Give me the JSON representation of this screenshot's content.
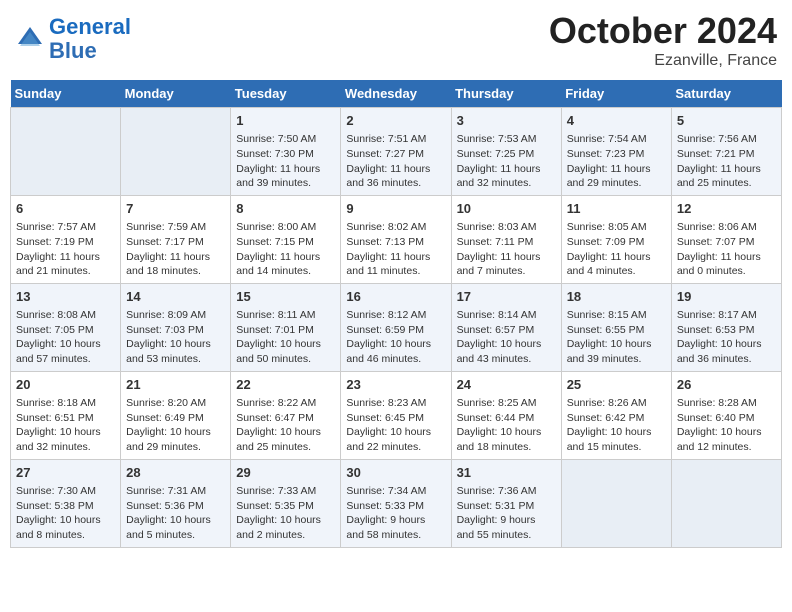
{
  "header": {
    "logo_line1": "General",
    "logo_line2": "Blue",
    "month": "October 2024",
    "location": "Ezanville, France"
  },
  "weekdays": [
    "Sunday",
    "Monday",
    "Tuesday",
    "Wednesday",
    "Thursday",
    "Friday",
    "Saturday"
  ],
  "weeks": [
    [
      {
        "day": "",
        "content": ""
      },
      {
        "day": "",
        "content": ""
      },
      {
        "day": "1",
        "content": "Sunrise: 7:50 AM\nSunset: 7:30 PM\nDaylight: 11 hours and 39 minutes."
      },
      {
        "day": "2",
        "content": "Sunrise: 7:51 AM\nSunset: 7:27 PM\nDaylight: 11 hours and 36 minutes."
      },
      {
        "day": "3",
        "content": "Sunrise: 7:53 AM\nSunset: 7:25 PM\nDaylight: 11 hours and 32 minutes."
      },
      {
        "day": "4",
        "content": "Sunrise: 7:54 AM\nSunset: 7:23 PM\nDaylight: 11 hours and 29 minutes."
      },
      {
        "day": "5",
        "content": "Sunrise: 7:56 AM\nSunset: 7:21 PM\nDaylight: 11 hours and 25 minutes."
      }
    ],
    [
      {
        "day": "6",
        "content": "Sunrise: 7:57 AM\nSunset: 7:19 PM\nDaylight: 11 hours and 21 minutes."
      },
      {
        "day": "7",
        "content": "Sunrise: 7:59 AM\nSunset: 7:17 PM\nDaylight: 11 hours and 18 minutes."
      },
      {
        "day": "8",
        "content": "Sunrise: 8:00 AM\nSunset: 7:15 PM\nDaylight: 11 hours and 14 minutes."
      },
      {
        "day": "9",
        "content": "Sunrise: 8:02 AM\nSunset: 7:13 PM\nDaylight: 11 hours and 11 minutes."
      },
      {
        "day": "10",
        "content": "Sunrise: 8:03 AM\nSunset: 7:11 PM\nDaylight: 11 hours and 7 minutes."
      },
      {
        "day": "11",
        "content": "Sunrise: 8:05 AM\nSunset: 7:09 PM\nDaylight: 11 hours and 4 minutes."
      },
      {
        "day": "12",
        "content": "Sunrise: 8:06 AM\nSunset: 7:07 PM\nDaylight: 11 hours and 0 minutes."
      }
    ],
    [
      {
        "day": "13",
        "content": "Sunrise: 8:08 AM\nSunset: 7:05 PM\nDaylight: 10 hours and 57 minutes."
      },
      {
        "day": "14",
        "content": "Sunrise: 8:09 AM\nSunset: 7:03 PM\nDaylight: 10 hours and 53 minutes."
      },
      {
        "day": "15",
        "content": "Sunrise: 8:11 AM\nSunset: 7:01 PM\nDaylight: 10 hours and 50 minutes."
      },
      {
        "day": "16",
        "content": "Sunrise: 8:12 AM\nSunset: 6:59 PM\nDaylight: 10 hours and 46 minutes."
      },
      {
        "day": "17",
        "content": "Sunrise: 8:14 AM\nSunset: 6:57 PM\nDaylight: 10 hours and 43 minutes."
      },
      {
        "day": "18",
        "content": "Sunrise: 8:15 AM\nSunset: 6:55 PM\nDaylight: 10 hours and 39 minutes."
      },
      {
        "day": "19",
        "content": "Sunrise: 8:17 AM\nSunset: 6:53 PM\nDaylight: 10 hours and 36 minutes."
      }
    ],
    [
      {
        "day": "20",
        "content": "Sunrise: 8:18 AM\nSunset: 6:51 PM\nDaylight: 10 hours and 32 minutes."
      },
      {
        "day": "21",
        "content": "Sunrise: 8:20 AM\nSunset: 6:49 PM\nDaylight: 10 hours and 29 minutes."
      },
      {
        "day": "22",
        "content": "Sunrise: 8:22 AM\nSunset: 6:47 PM\nDaylight: 10 hours and 25 minutes."
      },
      {
        "day": "23",
        "content": "Sunrise: 8:23 AM\nSunset: 6:45 PM\nDaylight: 10 hours and 22 minutes."
      },
      {
        "day": "24",
        "content": "Sunrise: 8:25 AM\nSunset: 6:44 PM\nDaylight: 10 hours and 18 minutes."
      },
      {
        "day": "25",
        "content": "Sunrise: 8:26 AM\nSunset: 6:42 PM\nDaylight: 10 hours and 15 minutes."
      },
      {
        "day": "26",
        "content": "Sunrise: 8:28 AM\nSunset: 6:40 PM\nDaylight: 10 hours and 12 minutes."
      }
    ],
    [
      {
        "day": "27",
        "content": "Sunrise: 7:30 AM\nSunset: 5:38 PM\nDaylight: 10 hours and 8 minutes."
      },
      {
        "day": "28",
        "content": "Sunrise: 7:31 AM\nSunset: 5:36 PM\nDaylight: 10 hours and 5 minutes."
      },
      {
        "day": "29",
        "content": "Sunrise: 7:33 AM\nSunset: 5:35 PM\nDaylight: 10 hours and 2 minutes."
      },
      {
        "day": "30",
        "content": "Sunrise: 7:34 AM\nSunset: 5:33 PM\nDaylight: 9 hours and 58 minutes."
      },
      {
        "day": "31",
        "content": "Sunrise: 7:36 AM\nSunset: 5:31 PM\nDaylight: 9 hours and 55 minutes."
      },
      {
        "day": "",
        "content": ""
      },
      {
        "day": "",
        "content": ""
      }
    ]
  ]
}
